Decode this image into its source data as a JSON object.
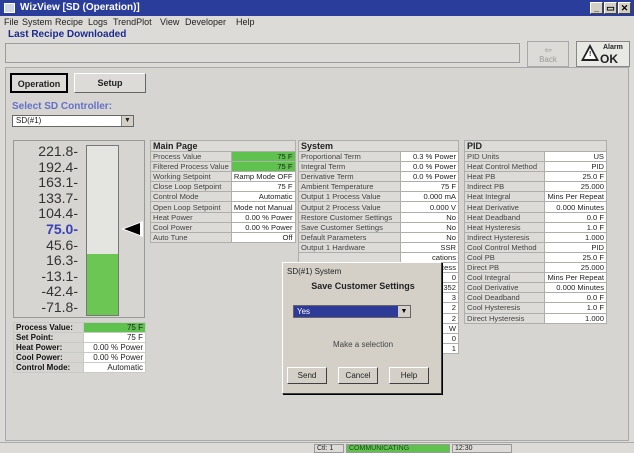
{
  "window": {
    "title": "WizView  [SD (Operation)]",
    "minimize": "_",
    "restore": "▭",
    "close": "✕"
  },
  "menu": [
    "File",
    "System",
    "Recipe",
    "Logs",
    "TrendPlot",
    "View",
    "Developer",
    "Help"
  ],
  "banner": {
    "title": "Last Recipe Downloaded",
    "back_label": "Back",
    "alarm_label": "Alarm",
    "alarm_status": "OK"
  },
  "tabs": {
    "operation": "Operation",
    "setup": "Setup"
  },
  "controller": {
    "label": "Select SD Controller:",
    "selected": "SD(#1)"
  },
  "gauge": {
    "scale": [
      "221.8-",
      "192.4-",
      "163.1-",
      "133.7-",
      "104.4-",
      "75.0-",
      "45.6-",
      "16.3-",
      "-13.1-",
      "-42.4-",
      "-71.8-"
    ],
    "current_index": 5,
    "fill_fraction": 0.36
  },
  "pv_summary": [
    {
      "label": "Process Value:",
      "value": "75 F",
      "highlight": true
    },
    {
      "label": "Set Point:",
      "value": "75 F",
      "highlight": false
    },
    {
      "label": "Heat Power:",
      "value": "0.00 % Power",
      "highlight": false
    },
    {
      "label": "Cool Power:",
      "value": "0.00 % Power",
      "highlight": false
    },
    {
      "label": "Control Mode:",
      "value": "Automatic",
      "highlight": false
    }
  ],
  "main_page": {
    "title": "Main Page",
    "rows": [
      {
        "label": "Process Value",
        "value": "75 F",
        "highlight": true
      },
      {
        "label": "Filtered Process Value",
        "value": "75 F",
        "highlight": true
      },
      {
        "label": "Working Setpoint",
        "value": "Ramp Mode OFF"
      },
      {
        "label": "Close Loop Setpoint",
        "value": "75 F"
      },
      {
        "label": "Control Mode",
        "value": "Automatic"
      },
      {
        "label": "Open Loop Setpoint",
        "value": "Mode not Manual"
      },
      {
        "label": "Heat Power",
        "value": "0.00 % Power"
      },
      {
        "label": "Cool Power",
        "value": "0.00 % Power"
      },
      {
        "label": "Auto Tune",
        "value": "Off"
      }
    ]
  },
  "system": {
    "title": "System",
    "rows": [
      {
        "label": "Proportional Term",
        "value": "0.3 % Power"
      },
      {
        "label": "Integral Term",
        "value": "0.0 % Power"
      },
      {
        "label": "Derivative Term",
        "value": "0.0 % Power"
      },
      {
        "label": "Ambient Temperature",
        "value": "75 F"
      },
      {
        "label": "Output 1 Process Value",
        "value": "0.000 mA"
      },
      {
        "label": "Output 2 Process Value",
        "value": "0.000 V"
      },
      {
        "label": "Restore Customer Settings",
        "value": "No"
      },
      {
        "label": "Save Customer Settings",
        "value": "No"
      },
      {
        "label": "Default Parameters",
        "value": "No"
      },
      {
        "label": "Output 1 Hardware",
        "value": "SSR"
      },
      {
        "label": "",
        "value": "cations"
      },
      {
        "label": "",
        "value": "rocess"
      },
      {
        "label": "",
        "value": "0"
      },
      {
        "label": "",
        "value": "352"
      },
      {
        "label": "",
        "value": "3"
      },
      {
        "label": "",
        "value": "2"
      },
      {
        "label": "",
        "value": "2"
      },
      {
        "label": "",
        "value": "W"
      },
      {
        "label": "",
        "value": "0"
      },
      {
        "label": "",
        "value": "1"
      }
    ]
  },
  "pid": {
    "title": "PID",
    "rows": [
      {
        "label": "PID Units",
        "value": "US"
      },
      {
        "label": "Heat Control Method",
        "value": "PID"
      },
      {
        "label": "Heat PB",
        "value": "25.0 F"
      },
      {
        "label": "Indirect PB",
        "value": "25.000"
      },
      {
        "label": "Heat Integral",
        "value": "Mins Per Repeat"
      },
      {
        "label": "Heat Derivative",
        "value": "0.000 Minutes"
      },
      {
        "label": "Heat Deadband",
        "value": "0.0 F"
      },
      {
        "label": "Heat Hysteresis",
        "value": "1.0 F"
      },
      {
        "label": "Indirect Hysteresis",
        "value": "1.000"
      },
      {
        "label": "Cool Control Method",
        "value": "PID"
      },
      {
        "label": "Cool PB",
        "value": "25.0 F"
      },
      {
        "label": "Direct PB",
        "value": "25.000"
      },
      {
        "label": "Cool Integral",
        "value": "Mins Per Repeat"
      },
      {
        "label": "Cool Derivative",
        "value": "0.000 Minutes"
      },
      {
        "label": "Cool Deadband",
        "value": "0.0 F"
      },
      {
        "label": "Cool Hysteresis",
        "value": "1.0 F"
      },
      {
        "label": "Direct Hysteresis",
        "value": "1.000"
      }
    ]
  },
  "dialog": {
    "title": "SD(#1) System",
    "heading": "Save Customer Settings",
    "selected": "Yes",
    "message": "Make a selection",
    "send": "Send",
    "cancel": "Cancel",
    "help": "Help"
  },
  "statusbar": {
    "left": "Ctl: 1",
    "comm": "COMMUNICATING",
    "time": "12:30"
  },
  "colors": {
    "title_bar": "#2a3d9a",
    "highlight_green": "#5fc24f",
    "heading_blue": "#1c2a8f",
    "selection_blue": "#2d3a98"
  }
}
